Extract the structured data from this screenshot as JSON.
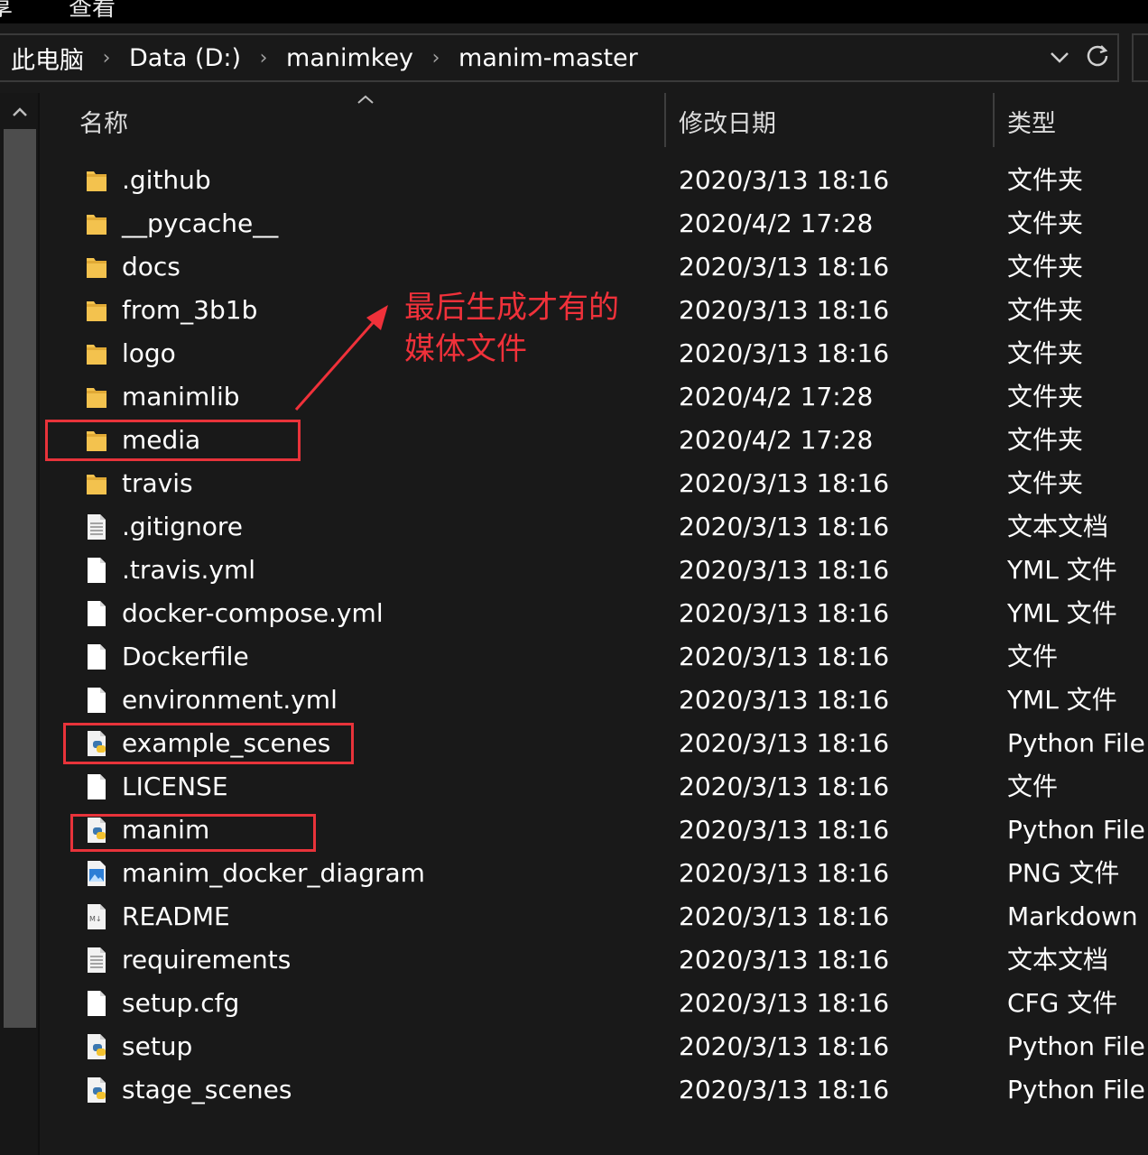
{
  "ribbon": {
    "items": [
      "享",
      "查看"
    ]
  },
  "address_bar": {
    "crumbs": [
      "此电脑",
      "Data (D:)",
      "manimkey",
      "manim-master"
    ],
    "separator": "›",
    "history_icon": "chevron-down-icon",
    "refresh_icon": "refresh-icon"
  },
  "columns": {
    "name": "名称",
    "date": "修改日期",
    "type": "类型"
  },
  "files": [
    {
      "name": ".github",
      "date": "2020/3/13 18:16",
      "type": "文件夹",
      "icon": "folder-icon"
    },
    {
      "name": "__pycache__",
      "date": "2020/4/2 17:28",
      "type": "文件夹",
      "icon": "folder-icon"
    },
    {
      "name": "docs",
      "date": "2020/3/13 18:16",
      "type": "文件夹",
      "icon": "folder-icon"
    },
    {
      "name": "from_3b1b",
      "date": "2020/3/13 18:16",
      "type": "文件夹",
      "icon": "folder-icon"
    },
    {
      "name": "logo",
      "date": "2020/3/13 18:16",
      "type": "文件夹",
      "icon": "folder-icon"
    },
    {
      "name": "manimlib",
      "date": "2020/4/2 17:28",
      "type": "文件夹",
      "icon": "folder-icon"
    },
    {
      "name": "media",
      "date": "2020/4/2 17:28",
      "type": "文件夹",
      "icon": "folder-icon"
    },
    {
      "name": "travis",
      "date": "2020/3/13 18:16",
      "type": "文件夹",
      "icon": "folder-icon"
    },
    {
      "name": ".gitignore",
      "date": "2020/3/13 18:16",
      "type": "文本文档",
      "icon": "text-file-icon"
    },
    {
      "name": ".travis.yml",
      "date": "2020/3/13 18:16",
      "type": "YML 文件",
      "icon": "file-icon"
    },
    {
      "name": "docker-compose.yml",
      "date": "2020/3/13 18:16",
      "type": "YML 文件",
      "icon": "file-icon"
    },
    {
      "name": "Dockerfile",
      "date": "2020/3/13 18:16",
      "type": "文件",
      "icon": "file-icon"
    },
    {
      "name": "environment.yml",
      "date": "2020/3/13 18:16",
      "type": "YML 文件",
      "icon": "file-icon"
    },
    {
      "name": "example_scenes",
      "date": "2020/3/13 18:16",
      "type": "Python File",
      "icon": "python-file-icon"
    },
    {
      "name": "LICENSE",
      "date": "2020/3/13 18:16",
      "type": "文件",
      "icon": "file-icon"
    },
    {
      "name": "manim",
      "date": "2020/3/13 18:16",
      "type": "Python File",
      "icon": "python-file-icon"
    },
    {
      "name": "manim_docker_diagram",
      "date": "2020/3/13 18:16",
      "type": "PNG 文件",
      "icon": "image-file-icon"
    },
    {
      "name": "README",
      "date": "2020/3/13 18:16",
      "type": "Markdown File",
      "icon": "markdown-file-icon"
    },
    {
      "name": "requirements",
      "date": "2020/3/13 18:16",
      "type": "文本文档",
      "icon": "text-file-icon"
    },
    {
      "name": "setup.cfg",
      "date": "2020/3/13 18:16",
      "type": "CFG 文件",
      "icon": "file-icon"
    },
    {
      "name": "setup",
      "date": "2020/3/13 18:16",
      "type": "Python File",
      "icon": "python-file-icon"
    },
    {
      "name": "stage_scenes",
      "date": "2020/3/13 18:16",
      "type": "Python File",
      "icon": "python-file-icon"
    }
  ],
  "annotation": {
    "lines": [
      "最后生成才有的",
      "媒体文件"
    ],
    "color": "#f0313a",
    "highlighted_items": [
      "media",
      "example_scenes",
      "manim"
    ]
  },
  "colors": {
    "background": "#191919",
    "folder": "#f3c24e",
    "highlight_box": "#e8333a"
  }
}
